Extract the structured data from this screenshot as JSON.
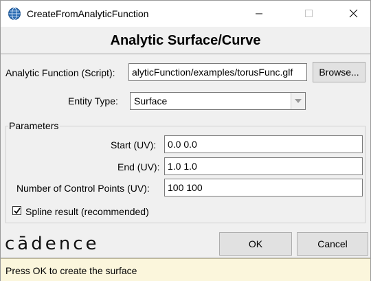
{
  "window": {
    "title": "CreateFromAnalyticFunction"
  },
  "dialog": {
    "heading": "Analytic Surface/Curve",
    "function_label": "Analytic Function (Script):",
    "function_value": "alyticFunction/examples/torusFunc.glf",
    "browse_label": "Browse...",
    "entity_type_label": "Entity Type:",
    "entity_type_value": "Surface"
  },
  "parameters": {
    "group_label": "Parameters",
    "start_label": "Start (UV):",
    "start_value": "0.0 0.0",
    "end_label": "End (UV):",
    "end_value": "1.0 1.0",
    "control_points_label": "Number of Control Points (UV):",
    "control_points_value": "100 100",
    "spline_label": "Spline result (recommended)",
    "spline_checked": true
  },
  "footer": {
    "logo_text": "cādence",
    "ok_label": "OK",
    "cancel_label": "Cancel"
  },
  "status": {
    "text": "Press OK to create the surface"
  },
  "icons": {
    "app": "globe-icon",
    "minimize": "minimize-icon",
    "maximize": "maximize-icon",
    "close": "close-icon",
    "combo": "chevron-down-icon",
    "check": "checkmark-icon"
  }
}
